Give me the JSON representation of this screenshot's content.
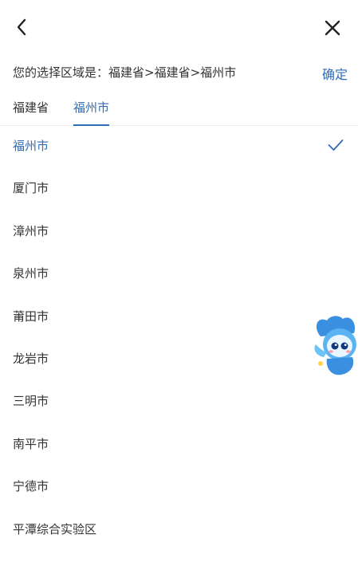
{
  "header": {
    "back_icon": "chevron-left-icon",
    "close_icon": "close-icon"
  },
  "selection": {
    "prefix": "您的选择区域是：",
    "path": "福建省>福建省>福州市",
    "confirm_label": "确定"
  },
  "tabs": [
    {
      "label": "福建省",
      "active": false
    },
    {
      "label": "福州市",
      "active": true
    }
  ],
  "cities": [
    {
      "label": "福州市",
      "selected": true
    },
    {
      "label": "厦门市",
      "selected": false
    },
    {
      "label": "漳州市",
      "selected": false
    },
    {
      "label": "泉州市",
      "selected": false
    },
    {
      "label": "莆田市",
      "selected": false
    },
    {
      "label": "龙岩市",
      "selected": false
    },
    {
      "label": "三明市",
      "selected": false
    },
    {
      "label": "南平市",
      "selected": false
    },
    {
      "label": "宁德市",
      "selected": false
    },
    {
      "label": "平潭综合实验区",
      "selected": false
    }
  ],
  "colors": {
    "accent": "#2f6db5",
    "text": "#333333",
    "divider": "#ececec"
  }
}
